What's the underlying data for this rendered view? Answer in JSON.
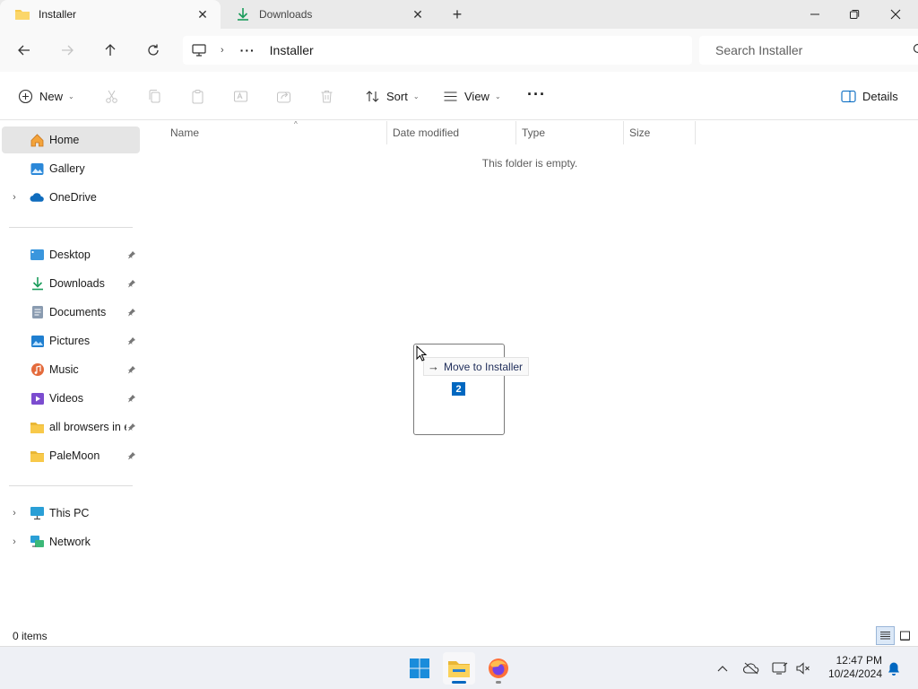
{
  "tabs": [
    {
      "label": "Installer",
      "icon": "folder-icon",
      "active": true
    },
    {
      "label": "Downloads",
      "icon": "downloads-icon",
      "active": false
    }
  ],
  "window_controls": {
    "minimize": "minimize-icon",
    "restore": "restore-icon",
    "close": "close-icon"
  },
  "address": {
    "more_label": "···",
    "current_folder": "Installer",
    "search_placeholder": "Search Installer"
  },
  "commandbar": {
    "new_label": "New",
    "sort_label": "Sort",
    "view_label": "View",
    "more_label": "···",
    "details_label": "Details"
  },
  "sidebar": {
    "home": "Home",
    "gallery": "Gallery",
    "onedrive": "OneDrive",
    "quick_access": [
      {
        "label": "Desktop",
        "icon": "desktop-icon"
      },
      {
        "label": "Downloads",
        "icon": "downloads-icon"
      },
      {
        "label": "Documents",
        "icon": "documents-icon"
      },
      {
        "label": "Pictures",
        "icon": "pictures-icon"
      },
      {
        "label": "Music",
        "icon": "music-icon"
      },
      {
        "label": "Videos",
        "icon": "videos-icon"
      },
      {
        "label": "all browsers in e",
        "icon": "folder-icon"
      },
      {
        "label": "PaleMoon",
        "icon": "folder-icon"
      }
    ],
    "this_pc": "This PC",
    "network": "Network"
  },
  "columns": [
    "Name",
    "Date modified",
    "Type",
    "Size"
  ],
  "empty_message": "This folder is empty.",
  "drag": {
    "tooltip": "Move to Installer",
    "count": "2"
  },
  "status": {
    "item_count": "0 items"
  },
  "clock": {
    "time": "12:47 PM",
    "date": "10/24/2024"
  },
  "colors": {
    "accent": "#0067c0",
    "folder": "#f8c94a",
    "selected_bg": "#e5e5e5"
  }
}
